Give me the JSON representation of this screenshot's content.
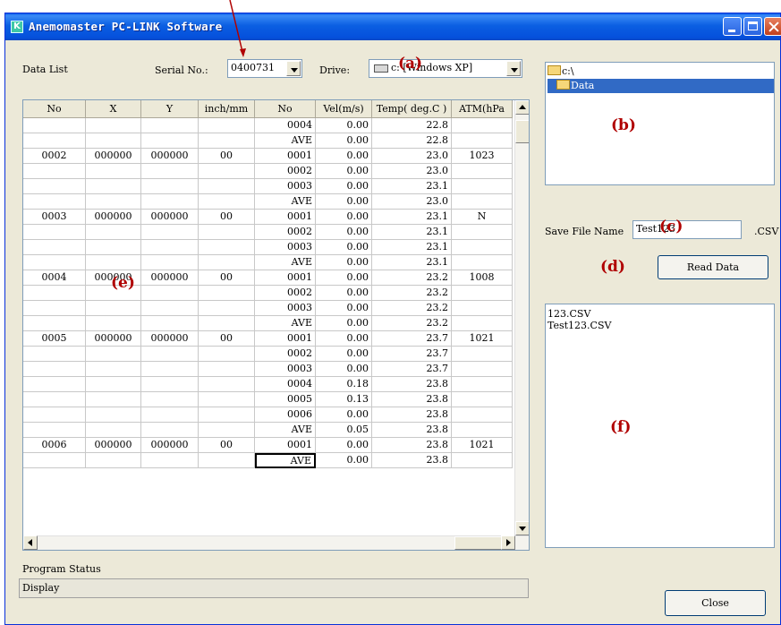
{
  "window": {
    "title": "Anemomaster PC-LINK Software",
    "app_icon": "K",
    "controls": [
      "minimize-icon",
      "maximize-icon",
      "close-icon"
    ]
  },
  "labels": {
    "data_list": "Data List",
    "serial_no": "Serial No.:",
    "drive": "Drive:",
    "save_file_name": "Save File Name",
    "csv_ext": ".CSV",
    "program_status": "Program Status"
  },
  "serial_combo": {
    "value": "0400731"
  },
  "drive_combo": {
    "value": "c: [Windows XP]",
    "icon": "drive-icon"
  },
  "table": {
    "columns": [
      "No",
      "X",
      "Y",
      "inch/mm",
      "No",
      "Vel(m/s)",
      "Temp( deg.C )",
      "ATM(hPa"
    ],
    "rows": [
      [
        "",
        "",
        "",
        "",
        "0004",
        "0.00",
        "22.8",
        ""
      ],
      [
        "",
        "",
        "",
        "",
        "AVE",
        "0.00",
        "22.8",
        ""
      ],
      [
        "0002",
        "000000",
        "000000",
        "00",
        "0001",
        "0.00",
        "23.0",
        "1023"
      ],
      [
        "",
        "",
        "",
        "",
        "0002",
        "0.00",
        "23.0",
        ""
      ],
      [
        "",
        "",
        "",
        "",
        "0003",
        "0.00",
        "23.1",
        ""
      ],
      [
        "",
        "",
        "",
        "",
        "AVE",
        "0.00",
        "23.0",
        ""
      ],
      [
        "0003",
        "000000",
        "000000",
        "00",
        "0001",
        "0.00",
        "23.1",
        "N"
      ],
      [
        "",
        "",
        "",
        "",
        "0002",
        "0.00",
        "23.1",
        ""
      ],
      [
        "",
        "",
        "",
        "",
        "0003",
        "0.00",
        "23.1",
        ""
      ],
      [
        "",
        "",
        "",
        "",
        "AVE",
        "0.00",
        "23.1",
        ""
      ],
      [
        "0004",
        "000000",
        "000000",
        "00",
        "0001",
        "0.00",
        "23.2",
        "1008"
      ],
      [
        "",
        "",
        "",
        "",
        "0002",
        "0.00",
        "23.2",
        ""
      ],
      [
        "",
        "",
        "",
        "",
        "0003",
        "0.00",
        "23.2",
        ""
      ],
      [
        "",
        "",
        "",
        "",
        "AVE",
        "0.00",
        "23.2",
        ""
      ],
      [
        "0005",
        "000000",
        "000000",
        "00",
        "0001",
        "0.00",
        "23.7",
        "1021"
      ],
      [
        "",
        "",
        "",
        "",
        "0002",
        "0.00",
        "23.7",
        ""
      ],
      [
        "",
        "",
        "",
        "",
        "0003",
        "0.00",
        "23.7",
        ""
      ],
      [
        "",
        "",
        "",
        "",
        "0004",
        "0.18",
        "23.8",
        ""
      ],
      [
        "",
        "",
        "",
        "",
        "0005",
        "0.13",
        "23.8",
        ""
      ],
      [
        "",
        "",
        "",
        "",
        "0006",
        "0.00",
        "23.8",
        ""
      ],
      [
        "",
        "",
        "",
        "",
        "AVE",
        "0.05",
        "23.8",
        ""
      ],
      [
        "0006",
        "000000",
        "000000",
        "00",
        "0001",
        "0.00",
        "23.8",
        "1021"
      ],
      [
        "",
        "",
        "",
        "",
        "AVE",
        "0.00",
        "23.8",
        ""
      ]
    ]
  },
  "folder_tree": [
    {
      "label": "c:\\",
      "selected": false,
      "icon": "open-folder-icon"
    },
    {
      "label": "Data",
      "selected": true,
      "icon": "open-folder-icon"
    }
  ],
  "save_file_name": {
    "value": "Test123"
  },
  "buttons": {
    "read_data": "Read Data",
    "close": "Close"
  },
  "file_list": [
    "123.CSV",
    "Test123.CSV"
  ],
  "status": {
    "text": "Display"
  },
  "markers": {
    "a": "(a)",
    "b": "(b)",
    "c": "(c)",
    "d": "(d)",
    "e": "(e)",
    "f": "(f)"
  },
  "colors": {
    "titlebar": "#0b5fe2",
    "selection": "#316ac5",
    "marker": "#b00000"
  }
}
